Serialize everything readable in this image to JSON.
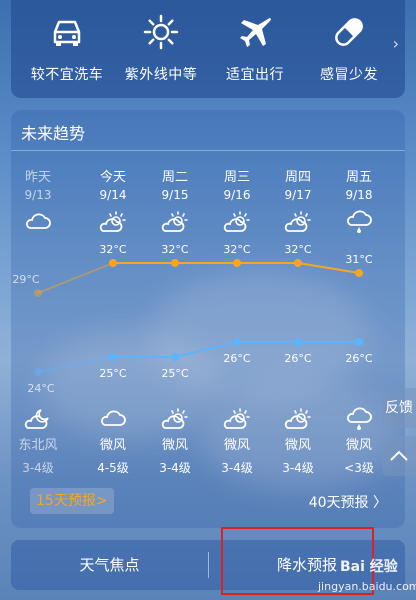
{
  "life_index": [
    {
      "icon": "car-wash-icon",
      "label": "较不宜洗车"
    },
    {
      "icon": "sun-uv-icon",
      "label": "紫外线中等"
    },
    {
      "icon": "airplane-icon",
      "label": "适宜出行"
    },
    {
      "icon": "pill-icon",
      "label": "感冒少发"
    }
  ],
  "trend": {
    "title": "未来趋势",
    "days": [
      {
        "day": "昨天",
        "date": "9/13",
        "day_icon": "cloudy-icon",
        "night_icon": "cloudy-moon-icon",
        "wind": "东北风",
        "level": "3-4级",
        "past": true
      },
      {
        "day": "今天",
        "date": "9/14",
        "day_icon": "partly-cloudy-icon",
        "night_icon": "cloudy-icon",
        "wind": "微风",
        "level": "4-5级",
        "past": false
      },
      {
        "day": "周二",
        "date": "9/15",
        "day_icon": "partly-cloudy-icon",
        "night_icon": "partly-cloudy-icon",
        "wind": "微风",
        "level": "3-4级",
        "past": false
      },
      {
        "day": "周三",
        "date": "9/16",
        "day_icon": "partly-cloudy-icon",
        "night_icon": "partly-cloudy-icon",
        "wind": "微风",
        "level": "3-4级",
        "past": false
      },
      {
        "day": "周四",
        "date": "9/17",
        "day_icon": "partly-cloudy-icon",
        "night_icon": "partly-cloudy-icon",
        "wind": "微风",
        "level": "3-4级",
        "past": false
      },
      {
        "day": "周五",
        "date": "9/18",
        "day_icon": "rain-icon",
        "night_icon": "rain-icon",
        "wind": "微风",
        "level": "<3级",
        "past": false
      }
    ],
    "forecast_15_label": "15天预报>",
    "forecast_40_label": "40天预报 〉"
  },
  "chart_data": {
    "type": "line",
    "categories": [
      "9/13",
      "9/14",
      "9/15",
      "9/16",
      "9/17",
      "9/18"
    ],
    "series": [
      {
        "values": [
          29,
          32,
          32,
          32,
          32,
          31
        ],
        "labels": [
          "29°C",
          "32°C",
          "32°C",
          "32°C",
          "32°C",
          "31°C"
        ],
        "color": "#f5a623"
      },
      {
        "values": [
          24,
          25,
          25,
          26,
          26,
          26
        ],
        "labels": [
          "24°C",
          "25°C",
          "25°C",
          "26°C",
          "26°C",
          "26°C"
        ],
        "color": "#5ab4ff"
      }
    ]
  },
  "side": {
    "feedback_label": "反馈",
    "collapse_icon": "chevron-up-icon"
  },
  "bottom_tabs": [
    {
      "label": "天气焦点"
    },
    {
      "label": "降水预报"
    }
  ],
  "watermark": {
    "logo_text": "Bai 经验",
    "url": "jingyan.baidu.com"
  },
  "colors": {
    "high_line": "#f5a623",
    "low_line": "#5ab4ff",
    "accent": "#f5a623",
    "highlight_box": "#e02020"
  }
}
